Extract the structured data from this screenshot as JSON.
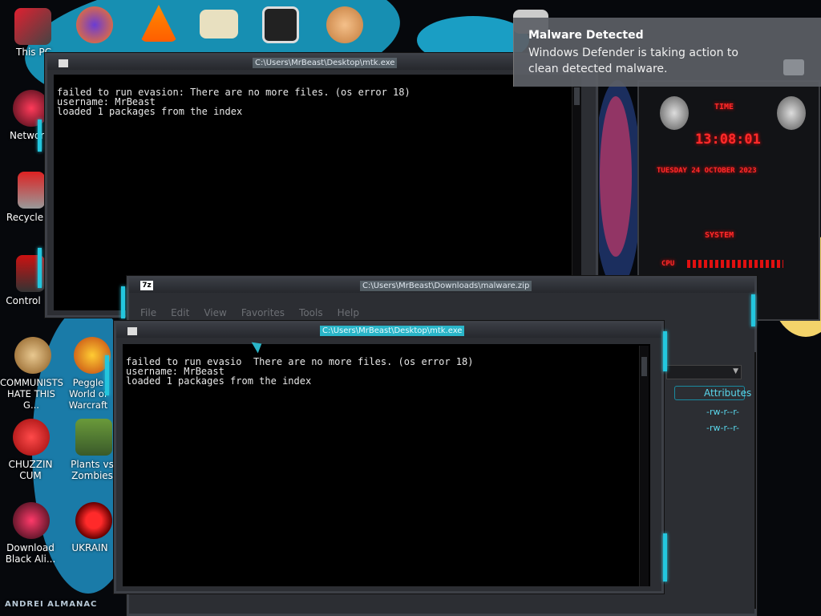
{
  "desktop": {
    "icons": [
      {
        "label": "This PC"
      },
      {
        "label": "Network"
      },
      {
        "label": "Recycle"
      },
      {
        "label": "Control"
      },
      {
        "label": "COMMUNISTS HATE THIS G..."
      },
      {
        "label": "Peggle World of Warcraft"
      },
      {
        "label": "CHUZZIN CUM"
      },
      {
        "label": "Plants vs Zombies"
      },
      {
        "label": "Download Black Ali..."
      },
      {
        "label": "UKRAIN"
      }
    ],
    "watermark": "ANDREI ALMANAC"
  },
  "notification": {
    "title": "Malware Detected",
    "body": "Windows Defender is taking action to clean detected malware."
  },
  "console_back": {
    "title": "C:\\Users\\MrBeast\\Desktop\\mtk.exe",
    "lines": [
      "failed to run evasion: There are no more files. (os error 18)",
      "username: MrBeast",
      "loaded 1 packages from the index"
    ]
  },
  "sevenzip": {
    "title": "C:\\Users\\MrBeast\\Downloads\\malware.zip",
    "app_icon": "7z",
    "menu": [
      "File",
      "Edit",
      "View",
      "Favorites",
      "Tools",
      "Help"
    ],
    "side_header": "Attributes",
    "side_rows": [
      "-rw-r--r-",
      "-rw-r--r-"
    ]
  },
  "console_front": {
    "title": "C:\\Users\\MrBeast\\Desktop\\mtk.exe",
    "lines": [
      "failed to run evasio  There are no more files. (os error 18)",
      "username: MrBeast",
      "loaded 1 packages from the index"
    ]
  },
  "gadget": {
    "time_label": "TIME",
    "time": "13:08:01",
    "date": "TUESDAY 24 OCTOBER 2023",
    "system_label": "SYSTEM",
    "cpu_label": "CPU"
  },
  "colors": {
    "accent": "#23c6de",
    "alert_red": "#ff2a2a"
  }
}
